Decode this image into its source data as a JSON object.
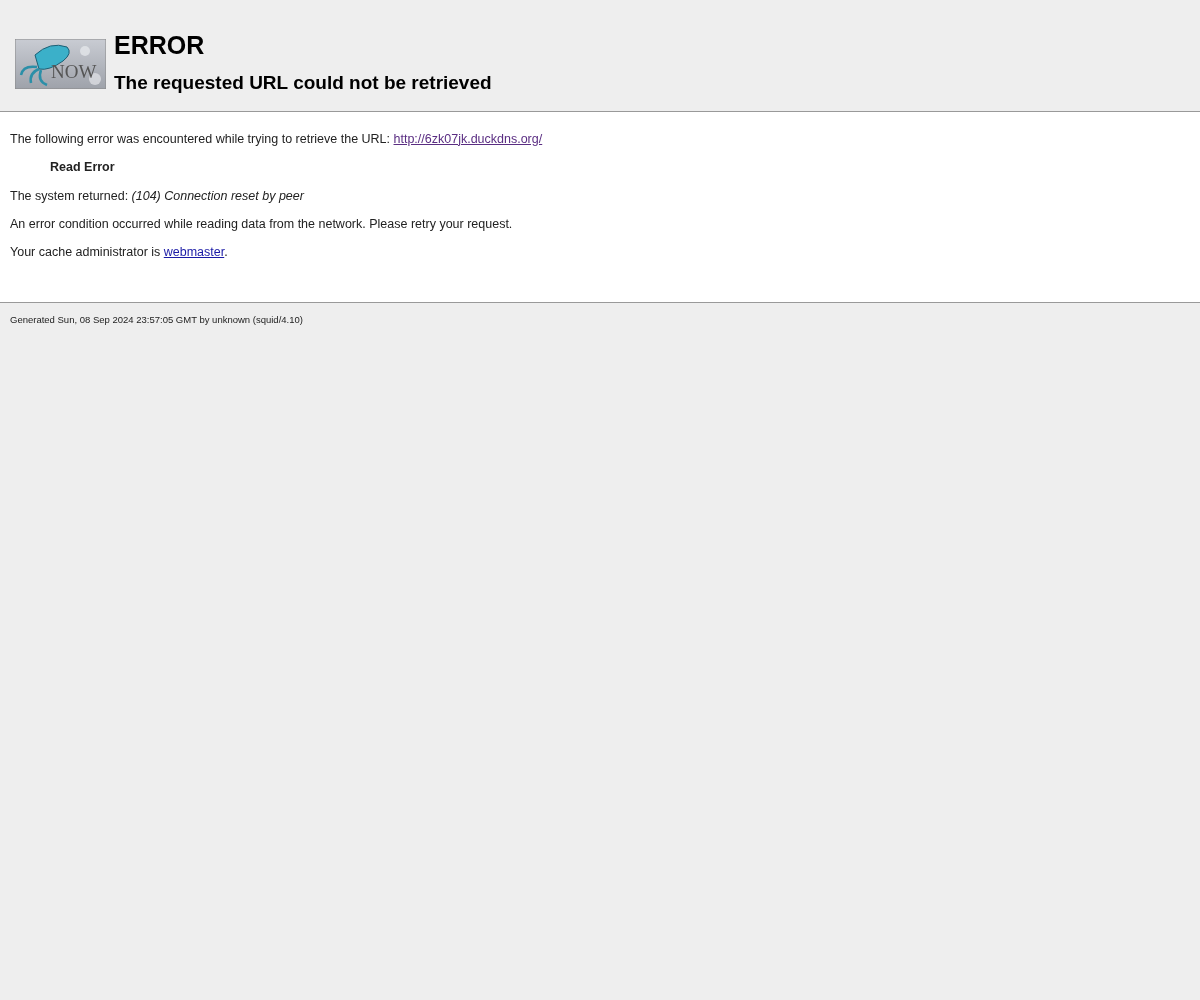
{
  "header": {
    "logo": {
      "text": "NOW"
    },
    "title": "ERROR",
    "subtitle": "The requested URL could not be retrieved"
  },
  "content": {
    "paragraphs": [
      {
        "kind": "link",
        "text": "The following error was encountered while trying to retrieve the URL: ",
        "link": {
          "label": "http://6zk07jk.duckdns.org/",
          "visited": true
        }
      },
      {
        "kind": "error",
        "text": "Read Error"
      },
      {
        "kind": "plain",
        "text": "The system returned: *(104) Connection reset by peer*"
      },
      {
        "kind": "plain",
        "text": "An error condition occurred while reading data from the network. Please retry your request."
      },
      {
        "kind": "link",
        "text": "Your cache administrator is ",
        "link": {
          "label": "webmaster",
          "visited": false
        },
        "after": "."
      }
    ]
  },
  "footer": {
    "text": "Generated Sun, 08 Sep 2024 23:57:05 GMT by unknown (squid/4.10)"
  }
}
